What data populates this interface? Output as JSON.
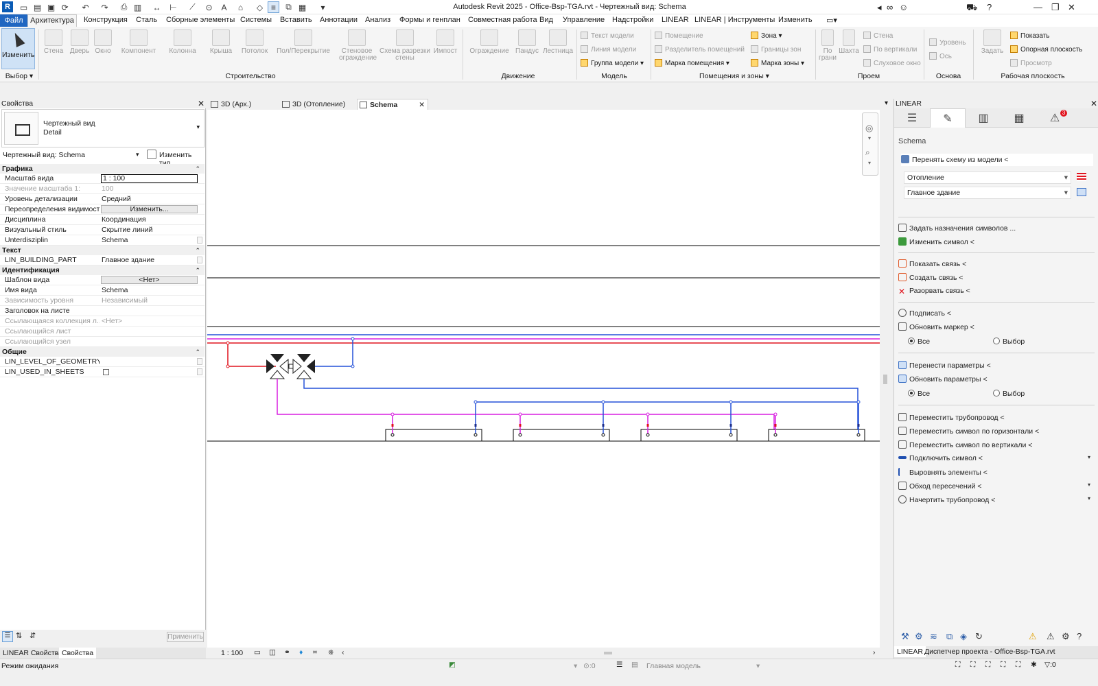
{
  "app": {
    "title": "Autodesk Revit 2025 - Office-Bsp-TGA.rvt - Чертежный вид: Schema",
    "logo": "R"
  },
  "menu": {
    "file": "Файл",
    "items": [
      "Архитектура",
      "Конструкция",
      "Сталь",
      "Сборные элементы",
      "Системы",
      "Вставить",
      "Аннотации",
      "Анализ",
      "Формы и генплан",
      "Совместная работа",
      "Вид",
      "Управление",
      "Надстройки",
      "LINEAR",
      "LINEAR | Инструменты",
      "Изменить"
    ]
  },
  "ribbon": {
    "modify": "Изменить",
    "select": "Выбор",
    "build_buttons": [
      "Стена",
      "Дверь",
      "Окно",
      "Компонент",
      "Колонна",
      "Крыша",
      "Потолок",
      "Пол/Перекрытие",
      "Стеновое ограждение",
      "Схема разрезки стены",
      "Импост"
    ],
    "move_buttons": [
      "Ограждение",
      "Пандус",
      "Лестница"
    ],
    "model_items": [
      "Текст модели",
      "Линия модели",
      "Группа модели"
    ],
    "rooms_items": [
      "Помещение",
      "Разделитель помещений",
      "Марка помещения",
      "Зона",
      "Границы зон",
      "Марка зоны"
    ],
    "opening_items": [
      "По грани",
      "Шахта",
      "Стена",
      "По вертикали",
      "Слуховое окно"
    ],
    "datum_items": [
      "Уровень",
      "Ось"
    ],
    "workplane_items": [
      "Задать",
      "Показать",
      "Опорная плоскость",
      "Просмотр"
    ],
    "panels": [
      "Строительство",
      "Движение",
      "Модель",
      "Помещения и зоны",
      "Проем",
      "Основа",
      "Рабочая плоскость"
    ]
  },
  "properties": {
    "header": "Свойства",
    "type_line1": "Чертежный вид",
    "type_line2": "Detail",
    "instance": "Чертежный вид: Schema",
    "edit_type": "Изменить тип",
    "groups": {
      "graphics": "Графика",
      "text": "Текст",
      "identity": "Идентификация",
      "general": "Общие"
    },
    "rows": {
      "scale": {
        "k": "Масштаб вида",
        "v": "1 : 100"
      },
      "scale_value": {
        "k": "Значение масштаба    1:",
        "v": "100"
      },
      "detail": {
        "k": "Уровень детализации",
        "v": "Средний"
      },
      "vg": {
        "k": "Переопределения видимост...",
        "v": "Изменить..."
      },
      "discipline": {
        "k": "Дисциплина",
        "v": "Координация"
      },
      "style": {
        "k": "Визуальный стиль",
        "v": "Скрытие линий"
      },
      "subdiscipline": {
        "k": "Unterdisziplin",
        "v": "Schema"
      },
      "building_part": {
        "k": "LIN_BUILDING_PART",
        "v": "Главное здание"
      },
      "template": {
        "k": "Шаблон вида",
        "v": "<Нет>"
      },
      "view_name": {
        "k": "Имя вида",
        "v": "Schema"
      },
      "dependency": {
        "k": "Зависимость уровня",
        "v": "Независимый"
      },
      "title_sheet": {
        "k": "Заголовок на листе",
        "v": ""
      },
      "ref_coll": {
        "k": "Ссылающаяся коллекция л...",
        "v": "<Нет>"
      },
      "ref_sheet": {
        "k": "Ссылающийся лист",
        "v": ""
      },
      "ref_node": {
        "k": "Ссылающийся узел",
        "v": ""
      },
      "log": {
        "k": "LIN_LEVEL_OF_GEOMETRY",
        "v": ""
      },
      "used": {
        "k": "LIN_USED_IN_SHEETS",
        "v": ""
      }
    },
    "apply": "Применить",
    "bottom_tabs": [
      "LINEAR Свойства",
      "Свойства"
    ]
  },
  "doc_tabs": [
    "3D (Арх.)",
    "3D (Отопление)",
    "Schema"
  ],
  "view_scale": "1 : 100",
  "status": {
    "text": "Режим ожидания",
    "workset": "Главная модель",
    "zero1": ":0",
    "zero2": ":0"
  },
  "linear": {
    "header": "LINEAR",
    "section": "Schema",
    "take_schema": "Перенять схему из модели <",
    "system": "Отопление",
    "building": "Главное здание",
    "actions1": [
      "Задать назначения символов ...",
      "Изменить символ <"
    ],
    "actions2": [
      "Показать связь <",
      "Создать связь <",
      "Разорвать связь <"
    ],
    "actions3": [
      "Подписать <",
      "Обновить маркер <"
    ],
    "all": "Все",
    "choice": "Выбор",
    "actions4": [
      "Перенести параметры <",
      "Обновить параметры <"
    ],
    "actions5": [
      "Переместить трубопровод <",
      "Переместить символ по горизонтали <",
      "Переместить символ по вертикали <",
      "Подключить символ <",
      "Выровнять элементы <",
      "Обход пересечений <",
      "Начертить трубопровод <"
    ],
    "bottom_tabs": [
      "LINEAR",
      "Диспетчер проекта - Office-Bsp-TGA.rvt"
    ],
    "badge": "3"
  },
  "colors": {
    "red": "#e0141e",
    "blue": "#2450d8",
    "magenta": "#d81ee0",
    "accent": "#1f66c1"
  }
}
